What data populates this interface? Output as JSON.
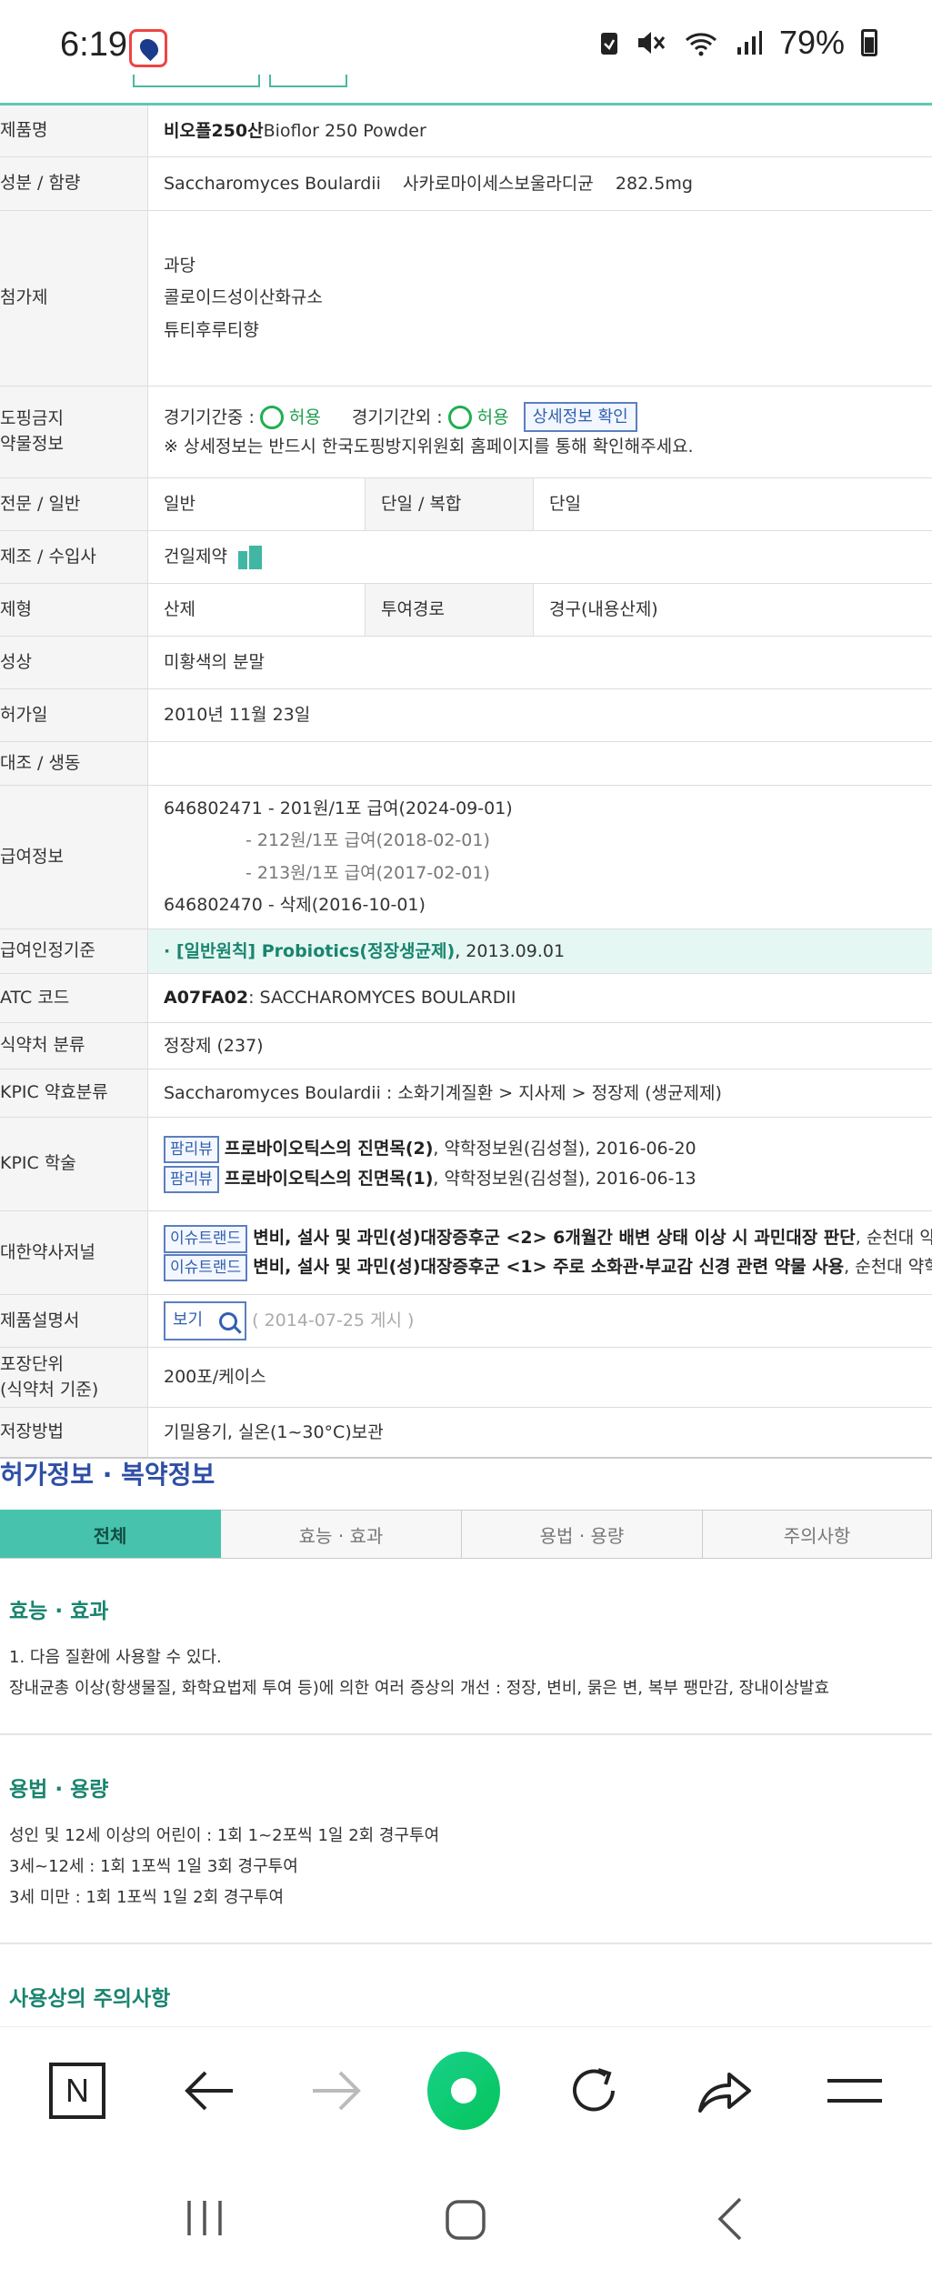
{
  "status_bar": {
    "time": "6:19",
    "battery": "79%"
  },
  "info_table": {
    "product_name": {
      "label": "제품명",
      "value_bold": "비오플250산",
      "value_rest": " Bioflor 250 Powder"
    },
    "ingredient": {
      "label": "성분 / 함량",
      "value": "Saccharomyces Boulardii    사카로마이세스보울라디균    282.5mg"
    },
    "additives": {
      "label": "첨가제",
      "lines": [
        "과당",
        "콜로이드성이산화규소",
        "튜티후루티향"
      ]
    },
    "doping": {
      "label": "도핑금지\n약물정보",
      "in_season_label": "경기기간중 :",
      "in_season_value": "허용",
      "out_season_label": "경기기간외 :",
      "out_season_value": "허용",
      "detail_button": "상세정보 확인",
      "note": "※ 상세정보는 반드시 한국도핑방지위원회 홈페이지를 통해 확인해주세요."
    },
    "otc": {
      "label": "전문 / 일반",
      "value": "일반",
      "sub_label": "단일 / 복합",
      "sub_value": "단일"
    },
    "manufacturer": {
      "label": "제조 / 수입사",
      "value": "건일제약"
    },
    "form": {
      "label": "제형",
      "value": "산제",
      "sub_label": "투여경로",
      "sub_value": "경구(내용산제)"
    },
    "appearance": {
      "label": "성상",
      "value": "미황색의 분말"
    },
    "approval_date": {
      "label": "허가일",
      "value": "2010년 11월 23일"
    },
    "generic": {
      "label": "대조 / 생동",
      "value": ""
    },
    "insurance": {
      "label": "급여정보",
      "lines": [
        "646802471 - 201원/1포 급여(2024-09-01)",
        "- 212원/1포 급여(2018-02-01)",
        "- 213원/1포 급여(2017-02-01)",
        "646802470 - 삭제(2016-10-01)"
      ]
    },
    "benefit_criteria": {
      "label": "급여인정기준",
      "link": "· [일반원칙] Probiotics(정장생균제)",
      "date": " , 2013.09.01"
    },
    "atc": {
      "label": "ATC 코드",
      "code": "A07FA02",
      "name": " : SACCHAROMYCES BOULARDII"
    },
    "mfds_class": {
      "label": "식약처 분류",
      "value": "정장제 (237)"
    },
    "kpic_class": {
      "label": "KPIC 약효분류",
      "value": "Saccharomyces Boulardii : 소화기계질환 > 지사제 > 정장제 (생균제제)"
    },
    "kpic_study": {
      "label": "KPIC 학술",
      "items": [
        {
          "tag": "팜리뷰",
          "title": "프로바이오틱스의 진면목(2)",
          "rest": ", 약학정보원(김성철), 2016-06-20"
        },
        {
          "tag": "팜리뷰",
          "title": "프로바이오틱스의 진면목(1)",
          "rest": ", 약학정보원(김성철), 2016-06-13"
        }
      ]
    },
    "journal": {
      "label": "대한약사저널",
      "items": [
        {
          "tag": "이슈트랜드",
          "title": "변비, 설사 및 과민(성)대장증후군 <2> 6개월간 배변 상태 이상 시 과민대장 판단",
          "rest": ", 순천대 약학대학 최경희 교"
        },
        {
          "tag": "이슈트랜드",
          "title": "변비, 설사 및 과민(성)대장증후군 <1> 주로 소화관·부교감 신경 관련 약물 사용",
          "rest": ", 순천대 약학대학 최경희 교수"
        }
      ]
    },
    "leaflet": {
      "label": "제품설명서",
      "button": "보기",
      "date": "( 2014-07-25 게시 )"
    },
    "package": {
      "label": "포장단위\n(식약처 기준)",
      "value": "200포/케이스"
    },
    "storage": {
      "label": "저장방법",
      "value": "기밀용기, 실온(1~30°C)보관"
    }
  },
  "section": {
    "title": "허가정보 · 복약정보",
    "tabs": [
      "전체",
      "효능 · 효과",
      "용법 · 용량",
      "주의사항"
    ],
    "efficacy": {
      "title": "효능 · 효과",
      "lines": [
        "1. 다음 질환에 사용할 수 있다.",
        "장내균총 이상(항생물질, 화학요법제 투여 등)에 의한 여러 증상의 개선 : 정장, 변비, 묽은 변, 복부 팽만감, 장내이상발효"
      ]
    },
    "dosage": {
      "title": "용법 · 용량",
      "lines": [
        "성인 및 12세 이상의 어린이 : 1회 1~2포씩 1일 2회 경구투여",
        "3세~12세 : 1회 1포씩 1일 3회 경구투여",
        "3세 미만 : 1회 1포씩 1일 2회 경구투여"
      ]
    },
    "caution": {
      "title": "사용상의 주의사항"
    }
  },
  "browser_bar": {
    "n_label": "N"
  },
  "colors": {
    "teal": "#47c3ad",
    "blue_title": "#2f4fa6",
    "green_ok": "#1fae51"
  }
}
